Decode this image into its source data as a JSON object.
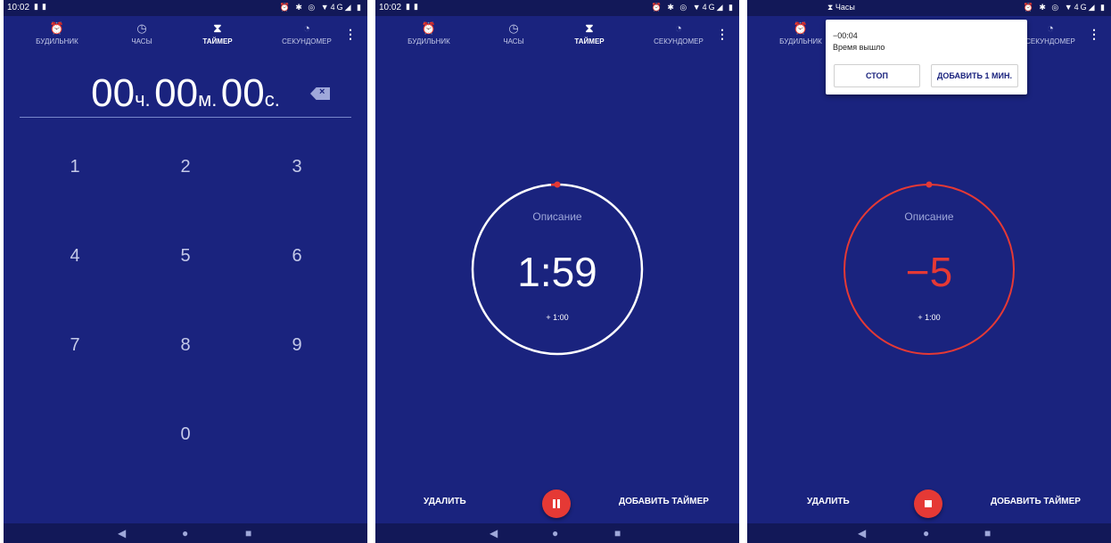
{
  "tabs": [
    {
      "label": "БУДИЛЬНИК",
      "icon": "alarm-icon"
    },
    {
      "label": "ЧАСЫ",
      "icon": "clock-icon"
    },
    {
      "label": "ТАЙМЕР",
      "icon": "hourglass-icon"
    },
    {
      "label": "СЕКУНДОМЕР",
      "icon": "stopwatch-icon"
    }
  ],
  "status": {
    "time": "10:02",
    "notif_app": "Часы"
  },
  "setup": {
    "hours": "00",
    "hours_unit": "ч.",
    "minutes": "00",
    "minutes_unit": "м.",
    "seconds": "00",
    "seconds_unit": "с.",
    "keys": [
      "1",
      "2",
      "3",
      "4",
      "5",
      "6",
      "7",
      "8",
      "9",
      "0"
    ]
  },
  "running": {
    "label": "Описание",
    "time": "1:59",
    "plus": "+ 1:00",
    "progress": 0.99
  },
  "expired": {
    "label": "Описание",
    "time": "−5",
    "plus": "+ 1:00"
  },
  "actions": {
    "delete": "УДАЛИТЬ",
    "add_timer": "ДОБАВИТЬ ТАЙМЕР"
  },
  "notification": {
    "time": "−00:04",
    "message": "Время вышло",
    "stop": "СТОП",
    "add_minute": "ДОБАВИТЬ 1 МИН."
  },
  "colors": {
    "background": "#1a237e",
    "accent": "#e53935",
    "ring": "#ffffff"
  }
}
